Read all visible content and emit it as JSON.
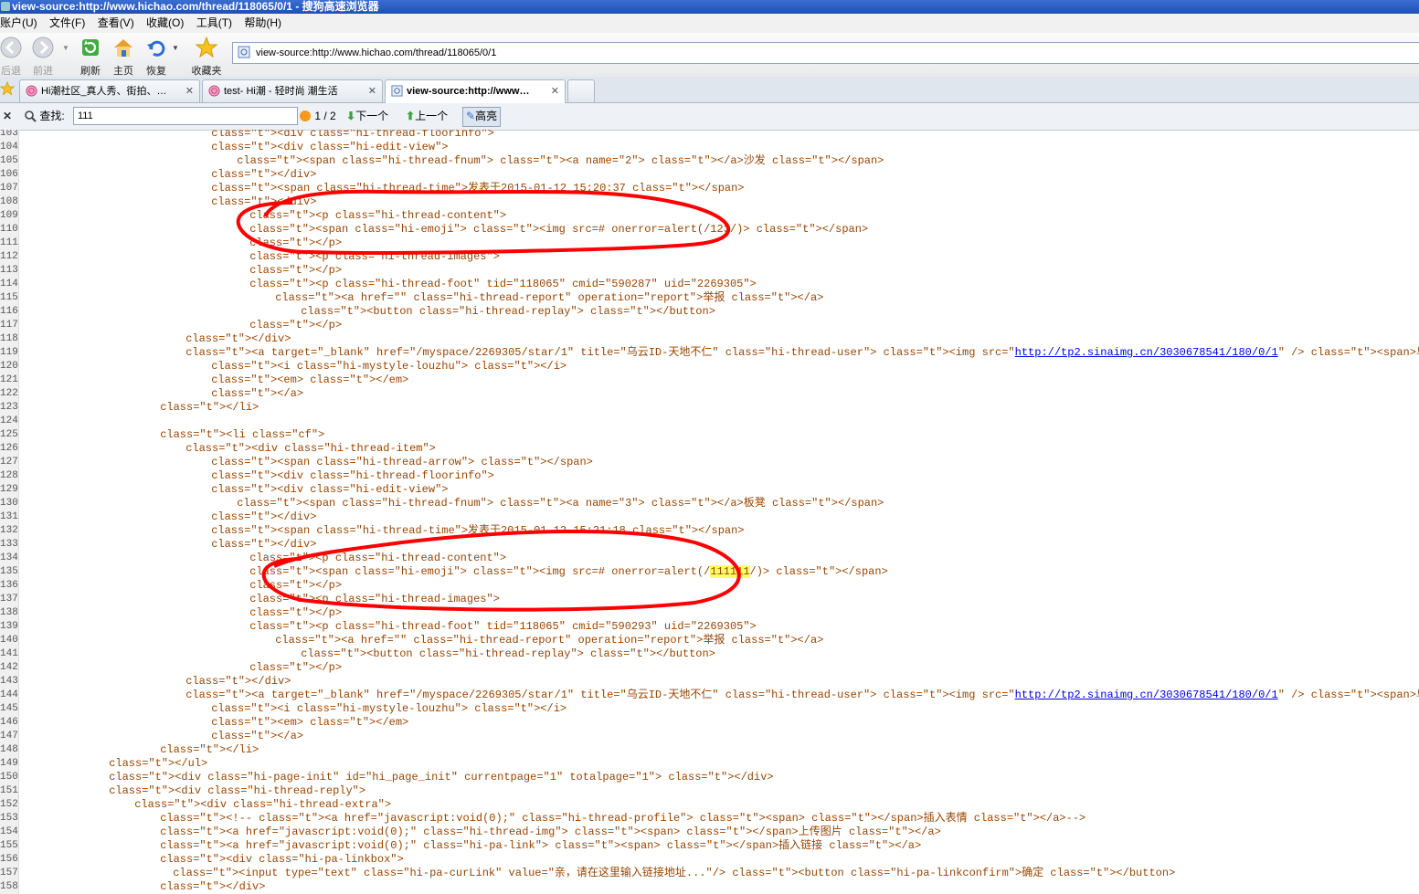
{
  "window": {
    "title": "view-source:http://www.hichao.com/thread/118065/0/1 - 搜狗高速浏览器"
  },
  "menu": [
    "账户(U)",
    "文件(F)",
    "查看(V)",
    "收藏(O)",
    "工具(T)",
    "帮助(H)"
  ],
  "toolbar": {
    "back": "后退",
    "forward": "前进",
    "refresh": "刷新",
    "home": "主页",
    "restore": "恢复",
    "favorites": "收藏夹",
    "address": "view-source:http://www.hichao.com/thread/118065/0/1"
  },
  "tabs": [
    {
      "label": "Hi潮社区_真人秀、街拍、…"
    },
    {
      "label": "test- Hi潮 - 轻时尚 潮生活"
    },
    {
      "label": "view-source:http://www…"
    }
  ],
  "find": {
    "label": "查找:",
    "query": "111",
    "count": "1 / 2",
    "next": "下一个",
    "prev": "上一个",
    "highlight": "高亮"
  },
  "source": {
    "lines": [
      {
        "n": "103",
        "i": 28,
        "h": "&lt;div class=\"hi-thread-floorinfo\"&gt;"
      },
      {
        "n": "104",
        "i": 28,
        "h": "&lt;div class=\"hi-edit-view\"&gt;"
      },
      {
        "n": "105",
        "i": 32,
        "h": "&lt;span class=\"hi-thread-fnum\"&gt;&lt;a name=\"2\"&gt;&lt;/a&gt;沙发&lt;/span&gt;"
      },
      {
        "n": "106",
        "i": 28,
        "h": "&lt;/div&gt;"
      },
      {
        "n": "107",
        "i": 28,
        "h": "&lt;span class=\"hi-thread-time\"&gt;发表于2015-01-12 15:20:37&lt;/span&gt;"
      },
      {
        "n": "108",
        "i": 28,
        "h": "&lt;/div&gt;"
      },
      {
        "n": "109",
        "i": 34,
        "h": "&lt;p class=\"hi-thread-content\"&gt;"
      },
      {
        "n": "110",
        "i": 34,
        "h": "&lt;span class=\"hi-emoji\"&gt;&lt;img src=# onerror=alert(/123/)&gt;&lt;/span&gt;"
      },
      {
        "n": "111",
        "i": 34,
        "h": "&lt;/p&gt;"
      },
      {
        "n": "112",
        "i": 34,
        "h": "&lt;p class=\"hi-thread-images\"&gt;"
      },
      {
        "n": "113",
        "i": 34,
        "h": "&lt;/p&gt;"
      },
      {
        "n": "114",
        "i": 34,
        "h": "&lt;p class=\"hi-thread-foot\" tid=\"118065\" cmid=\"590287\" uid=\"2269305\"&gt;"
      },
      {
        "n": "115",
        "i": 38,
        "h": "&lt;a href=\"\" class=\"hi-thread-report\" operation=\"report\"&gt;举报&lt;/a&gt;"
      },
      {
        "n": "116",
        "i": 42,
        "h": "&lt;button class=\"hi-thread-replay\"&gt;&lt;/button&gt;"
      },
      {
        "n": "117",
        "i": 34,
        "h": "&lt;/p&gt;"
      },
      {
        "n": "118",
        "i": 24,
        "h": "&lt;/div&gt;"
      },
      {
        "n": "119",
        "i": 24,
        "h": "&lt;a target=\"_blank\" href=\"/myspace/2269305/star/1\" title=\"乌云ID-天地不仁\" class=\"hi-thread-user\"&gt;&lt;img src=\"http://tp2.sinaimg.cn/3030678541/180/0/1\" /&gt;&lt;span&gt;乌云ID-天地不仁&lt;/span&gt;"
      },
      {
        "n": "120",
        "i": 28,
        "h": "&lt;i class=\"hi-mystyle-louzhu\"&gt;&lt;/i&gt;"
      },
      {
        "n": "121",
        "i": 28,
        "h": "&lt;em&gt;&lt;/em&gt;"
      },
      {
        "n": "122",
        "i": 28,
        "h": "&lt;/a&gt;"
      },
      {
        "n": "123",
        "i": 20,
        "h": "&lt;/li&gt;"
      },
      {
        "n": "124",
        "i": 0,
        "h": ""
      },
      {
        "n": "125",
        "i": 20,
        "h": "&lt;li class=\"cf\"&gt;"
      },
      {
        "n": "126",
        "i": 24,
        "h": "&lt;div class=\"hi-thread-item\"&gt;"
      },
      {
        "n": "127",
        "i": 28,
        "h": "&lt;span class=\"hi-thread-arrow\"&gt;&lt;/span&gt;"
      },
      {
        "n": "128",
        "i": 28,
        "h": "&lt;div class=\"hi-thread-floorinfo\"&gt;"
      },
      {
        "n": "129",
        "i": 28,
        "h": "&lt;div class=\"hi-edit-view\"&gt;"
      },
      {
        "n": "130",
        "i": 32,
        "h": "&lt;span class=\"hi-thread-fnum\"&gt;&lt;a name=\"3\"&gt;&lt;/a&gt;板凳&lt;/span&gt;"
      },
      {
        "n": "131",
        "i": 28,
        "h": "&lt;/div&gt;"
      },
      {
        "n": "132",
        "i": 28,
        "h": "&lt;span class=\"hi-thread-time\"&gt;发表于2015-01-12 15:21:18&lt;/span&gt;"
      },
      {
        "n": "133",
        "i": 28,
        "h": "&lt;/div&gt;"
      },
      {
        "n": "134",
        "i": 34,
        "h": "&lt;p class=\"hi-thread-content\"&gt;"
      },
      {
        "n": "135",
        "i": 34,
        "h": "&lt;span class=\"hi-emoji\"&gt;&lt;img src=# onerror=alert(/111111/)&gt;&lt;/span&gt;"
      },
      {
        "n": "136",
        "i": 34,
        "h": "&lt;/p&gt;"
      },
      {
        "n": "137",
        "i": 34,
        "h": "&lt;p class=\"hi-thread-images\"&gt;"
      },
      {
        "n": "138",
        "i": 34,
        "h": "&lt;/p&gt;"
      },
      {
        "n": "139",
        "i": 34,
        "h": "&lt;p class=\"hi-thread-foot\" tid=\"118065\" cmid=\"590293\" uid=\"2269305\"&gt;"
      },
      {
        "n": "140",
        "i": 38,
        "h": "&lt;a href=\"\" class=\"hi-thread-report\" operation=\"report\"&gt;举报&lt;/a&gt;"
      },
      {
        "n": "141",
        "i": 42,
        "h": "&lt;button class=\"hi-thread-replay\"&gt;&lt;/button&gt;"
      },
      {
        "n": "142",
        "i": 34,
        "h": "&lt;/p&gt;"
      },
      {
        "n": "143",
        "i": 24,
        "h": "&lt;/div&gt;"
      },
      {
        "n": "144",
        "i": 24,
        "h": "&lt;a target=\"_blank\" href=\"/myspace/2269305/star/1\" title=\"乌云ID-天地不仁\" class=\"hi-thread-user\"&gt;&lt;img src=\"http://tp2.sinaimg.cn/3030678541/180/0/1\" /&gt;&lt;span&gt;乌云ID-天地不仁&lt;/span&gt;"
      },
      {
        "n": "145",
        "i": 28,
        "h": "&lt;i class=\"hi-mystyle-louzhu\"&gt;&lt;/i&gt;"
      },
      {
        "n": "146",
        "i": 28,
        "h": "&lt;em&gt;&lt;/em&gt;"
      },
      {
        "n": "147",
        "i": 28,
        "h": "&lt;/a&gt;"
      },
      {
        "n": "148",
        "i": 20,
        "h": "&lt;/li&gt;"
      },
      {
        "n": "149",
        "i": 12,
        "h": "&lt;/ul&gt;"
      },
      {
        "n": "150",
        "i": 12,
        "h": "&lt;div class=\"hi-page-init\" id=\"hi_page_init\" currentpage=\"1\" totalpage=\"1\"&gt;&lt;/div&gt;"
      },
      {
        "n": "151",
        "i": 12,
        "h": "&lt;div class=\"hi-thread-reply\"&gt;"
      },
      {
        "n": "152",
        "i": 16,
        "h": "&lt;div class=\"hi-thread-extra\"&gt;"
      },
      {
        "n": "153",
        "i": 20,
        "h": "&lt;!--&lt;a href=\"javascript:void(0);\" class=\"hi-thread-profile\"&gt;&lt;span&gt;&lt;/span&gt;插入表情&lt;/a&gt;--&gt;"
      },
      {
        "n": "154",
        "i": 20,
        "h": "&lt;a href=\"javascript:void(0);\" class=\"hi-thread-img\"&gt;&lt;span&gt;&lt;/span&gt;上传图片&lt;/a&gt;"
      },
      {
        "n": "155",
        "i": 20,
        "h": "&lt;a href=\"javascript:void(0);\" class=\"hi-pa-link\"&gt;&lt;span&gt;&lt;/span&gt;插入链接&lt;/a&gt;"
      },
      {
        "n": "156",
        "i": 20,
        "h": "&lt;div class=\"hi-pa-linkbox\"&gt;"
      },
      {
        "n": "157",
        "i": 22,
        "h": "&lt;input type=\"text\" class=\"hi-pa-curLink\" value=\"亲，请在这里输入链接地址...\"/&gt;&lt;button class=\"hi-pa-linkconfirm\"&gt;确定&lt;/button&gt;"
      },
      {
        "n": "158",
        "i": 20,
        "h": "&lt;/div&gt;"
      }
    ]
  }
}
